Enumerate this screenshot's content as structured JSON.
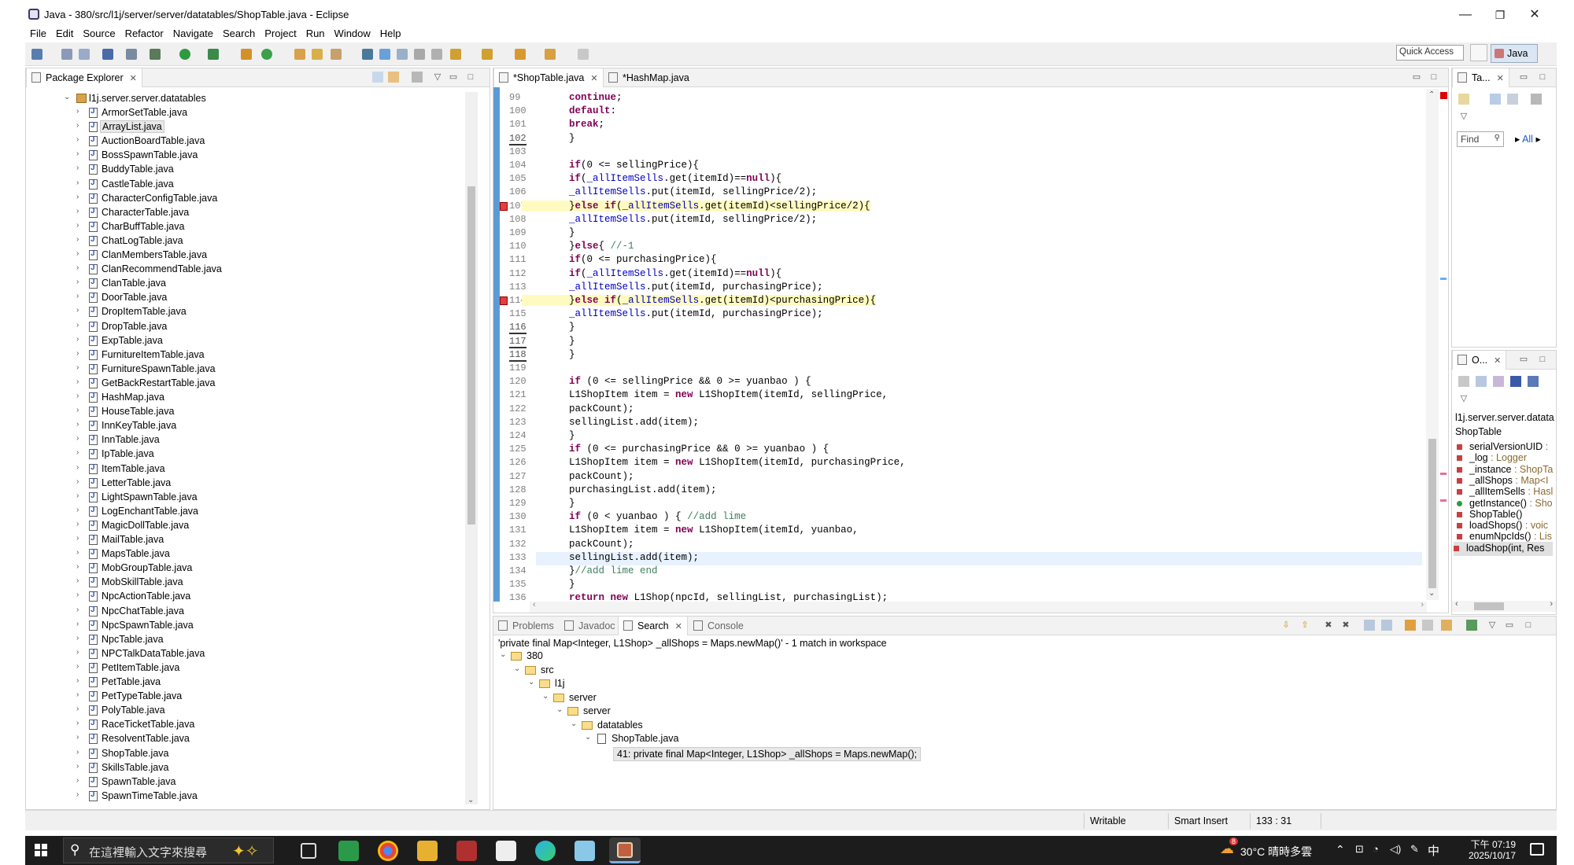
{
  "window": {
    "title": "Java - 380/src/l1j/server/server/datatables/ShopTable.java - Eclipse",
    "minimize": "—",
    "maximize": "❐",
    "close": "✕"
  },
  "menu": [
    "File",
    "Edit",
    "Source",
    "Refactor",
    "Navigate",
    "Search",
    "Project",
    "Run",
    "Window",
    "Help"
  ],
  "toolbar": {
    "quick_access": "Quick Access",
    "perspective": "Java"
  },
  "package_explorer": {
    "tab_label": "Package Explorer",
    "package": "l1j.server.server.datatables",
    "files": [
      "ArmorSetTable.java",
      "ArrayList.java",
      "AuctionBoardTable.java",
      "BossSpawnTable.java",
      "BuddyTable.java",
      "CastleTable.java",
      "CharacterConfigTable.java",
      "CharacterTable.java",
      "CharBuffTable.java",
      "ChatLogTable.java",
      "ClanMembersTable.java",
      "ClanRecommendTable.java",
      "ClanTable.java",
      "DoorTable.java",
      "DropItemTable.java",
      "DropTable.java",
      "ExpTable.java",
      "FurnitureItemTable.java",
      "FurnitureSpawnTable.java",
      "GetBackRestartTable.java",
      "HashMap.java",
      "HouseTable.java",
      "InnKeyTable.java",
      "InnTable.java",
      "IpTable.java",
      "ItemTable.java",
      "LetterTable.java",
      "LightSpawnTable.java",
      "LogEnchantTable.java",
      "MagicDollTable.java",
      "MailTable.java",
      "MapsTable.java",
      "MobGroupTable.java",
      "MobSkillTable.java",
      "NpcActionTable.java",
      "NpcChatTable.java",
      "NpcSpawnTable.java",
      "NpcTable.java",
      "NPCTalkDataTable.java",
      "PetItemTable.java",
      "PetTable.java",
      "PetTypeTable.java",
      "PolyTable.java",
      "RaceTicketTable.java",
      "ResolventTable.java",
      "ShopTable.java",
      "SkillsTable.java",
      "SpawnTable.java",
      "SpawnTimeTable.java"
    ]
  },
  "editor": {
    "tabs": [
      "*ShopTable.java",
      "*HashMap.java"
    ],
    "lines": [
      {
        "n": "99",
        "code": "        continue;"
      },
      {
        "n": "100",
        "code": "        default:"
      },
      {
        "n": "101",
        "code": "        break;"
      },
      {
        "n": "102",
        "code": "        }"
      },
      {
        "n": "103",
        "code": ""
      },
      {
        "n": "104",
        "code": "        if(0 <= sellingPrice){"
      },
      {
        "n": "105",
        "code": "        if(_allItemSells.get(itemId)==null){"
      },
      {
        "n": "106",
        "code": "        _allItemSells.put(itemId, sellingPrice/2);"
      },
      {
        "n": "107",
        "code": "        }else if(_allItemSells.get(itemId)<sellingPrice/2){"
      },
      {
        "n": "108",
        "code": "        _allItemSells.put(itemId, sellingPrice/2);"
      },
      {
        "n": "109",
        "code": "        }"
      },
      {
        "n": "110",
        "code": "        }else{ //-1"
      },
      {
        "n": "111",
        "code": "        if(0 <= purchasingPrice){"
      },
      {
        "n": "112",
        "code": "        if(_allItemSells.get(itemId)==null){"
      },
      {
        "n": "113",
        "code": "        _allItemSells.put(itemId, purchasingPrice);"
      },
      {
        "n": "114",
        "code": "        }else if(_allItemSells.get(itemId)<purchasingPrice){"
      },
      {
        "n": "115",
        "code": "        _allItemSells.put(itemId, purchasingPrice);"
      },
      {
        "n": "116",
        "code": "        }"
      },
      {
        "n": "117",
        "code": "        }"
      },
      {
        "n": "118",
        "code": "        }"
      },
      {
        "n": "119",
        "code": ""
      },
      {
        "n": "120",
        "code": "        if (0 <= sellingPrice && 0 >= yuanbao ) {"
      },
      {
        "n": "121",
        "code": "        L1ShopItem item = new L1ShopItem(itemId, sellingPrice,"
      },
      {
        "n": "122",
        "code": "        packCount);"
      },
      {
        "n": "123",
        "code": "        sellingList.add(item);"
      },
      {
        "n": "124",
        "code": "        }"
      },
      {
        "n": "125",
        "code": "        if (0 <= purchasingPrice && 0 >= yuanbao ) {"
      },
      {
        "n": "126",
        "code": "        L1ShopItem item = new L1ShopItem(itemId, purchasingPrice,"
      },
      {
        "n": "127",
        "code": "        packCount);"
      },
      {
        "n": "128",
        "code": "        purchasingList.add(item);"
      },
      {
        "n": "129",
        "code": "        }"
      },
      {
        "n": "130",
        "code": "        if (0 < yuanbao ) { //add lime"
      },
      {
        "n": "131",
        "code": "        L1ShopItem item = new L1ShopItem(itemId, yuanbao,"
      },
      {
        "n": "132",
        "code": "        packCount);"
      },
      {
        "n": "133",
        "code": "        sellingList.add(item);"
      },
      {
        "n": "134",
        "code": "        }//add lime end"
      },
      {
        "n": "135",
        "code": "        }"
      },
      {
        "n": "136",
        "code": "        return new L1Shop(npcId, sellingList, purchasingList);"
      }
    ]
  },
  "right_top": {
    "tab_label": "Ta...",
    "find_placeholder": "Find",
    "all_label": "All"
  },
  "outline": {
    "tab_label": "O...",
    "package": "l1j.server.server.datata",
    "class": "ShopTable",
    "members": [
      {
        "name": "serialVersionUID",
        "type": " :"
      },
      {
        "name": "_log",
        "type": " : Logger"
      },
      {
        "name": "_instance",
        "type": " : ShopTa"
      },
      {
        "name": "_allShops",
        "type": " : Map<I"
      },
      {
        "name": "_allItemSells",
        "type": " : Hasl"
      },
      {
        "name": "getInstance()",
        "type": " : Sho"
      },
      {
        "name": "ShopTable()",
        "type": ""
      },
      {
        "name": "loadShops()",
        "type": " : voic"
      },
      {
        "name": "enumNpcIds()",
        "type": " : Lis"
      },
      {
        "name": "loadShop(int, Res",
        "type": ""
      }
    ]
  },
  "bottom": {
    "tabs": [
      "Problems",
      "Javadoc",
      "Search",
      "Console"
    ],
    "search_summary": "'private final Map<Integer, L1Shop> _allShops = Maps.newMap()' - 1 match in workspace",
    "tree": [
      "380",
      "src",
      "l1j",
      "server",
      "server",
      "datatables",
      "ShopTable.java"
    ],
    "match": "41: private final Map<Integer, L1Shop> _allShops = Maps.newMap();"
  },
  "status": {
    "writable": "Writable",
    "insert_mode": "Smart Insert",
    "position": "133 : 31"
  },
  "taskbar": {
    "search_placeholder": "在這裡輸入文字來搜尋",
    "weather": "30°C  晴時多雲",
    "ime": "中",
    "time": "下午 07:19",
    "date": "2025/10/17",
    "badge": "8"
  }
}
